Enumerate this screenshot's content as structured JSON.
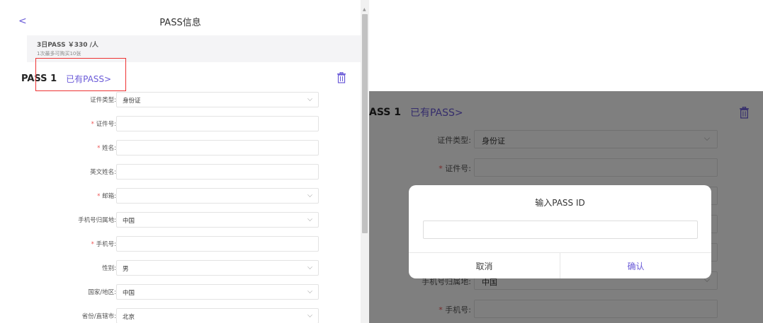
{
  "left": {
    "back_glyph": "<",
    "nav_title": "PASS信息",
    "pass_summary": "3日PASS ￥330 /人",
    "pass_limit": "1次最多可购买10张",
    "passenger_label": "PASS 1",
    "have_pass_link": "已有PASS",
    "fields": [
      {
        "label": "证件类型:",
        "required": false,
        "value": "身份证",
        "select": true
      },
      {
        "label": "证件号:",
        "required": true,
        "value": "",
        "select": false
      },
      {
        "label": "姓名:",
        "required": true,
        "value": "",
        "select": false
      },
      {
        "label": "英文姓名:",
        "required": false,
        "value": "",
        "select": false
      },
      {
        "label": "邮箱:",
        "required": true,
        "value": "",
        "select": true
      },
      {
        "label": "手机号归属地:",
        "required": false,
        "value": "中国",
        "select": true
      },
      {
        "label": "手机号:",
        "required": true,
        "value": "",
        "select": false
      },
      {
        "label": "性别:",
        "required": false,
        "value": "男",
        "select": true
      },
      {
        "label": "国家/地区:",
        "required": false,
        "value": "中国",
        "select": true
      },
      {
        "label": "省份/直辖市:",
        "required": false,
        "value": "北京",
        "select": true
      }
    ]
  },
  "right": {
    "passenger_label": "ASS 1",
    "have_pass_link": "已有PASS",
    "fields": [
      {
        "label": "证件类型:",
        "required": false,
        "value": "身份证",
        "select": true
      },
      {
        "label": "证件号:",
        "required": true,
        "value": "",
        "select": false
      },
      {
        "label": "",
        "required": false,
        "value": "",
        "select": false
      },
      {
        "label": "",
        "required": false,
        "value": "",
        "select": false
      },
      {
        "label": "",
        "required": false,
        "value": "",
        "select": false
      },
      {
        "label": "手机号归属地:",
        "required": false,
        "value": "中国",
        "select": true
      },
      {
        "label": "手机号:",
        "required": true,
        "value": "",
        "select": false
      }
    ],
    "dialog": {
      "title": "输入PASS ID",
      "input_value": "",
      "cancel_label": "取消",
      "confirm_label": "确认"
    }
  },
  "colors": {
    "accent": "#6a5ad8",
    "required": "#e55555",
    "highlight": "#e33333"
  },
  "icons": {
    "back": "chevron-left-icon",
    "trash": "trash-icon",
    "dropdown": "chevron-down-icon",
    "have_pass": "chevron-right-icon"
  }
}
